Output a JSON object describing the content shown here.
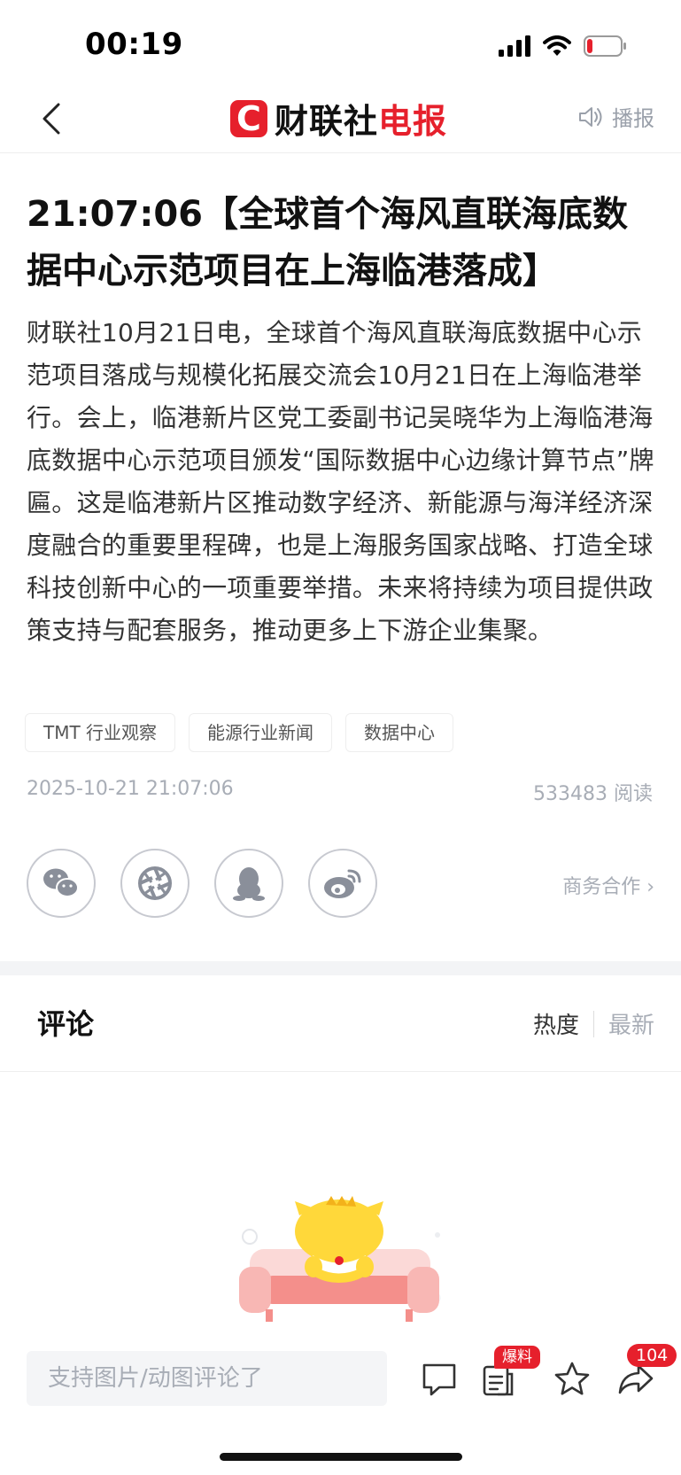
{
  "status": {
    "time": "00:19"
  },
  "nav": {
    "logo_letter": "C",
    "logo_black": "财联社",
    "logo_red": "电报",
    "broadcast_label": "播报"
  },
  "article": {
    "title": "21:07:06【全球首个海风直联海底数据中心示范项目在上海临港落成】",
    "body": "财联社10月21日电，全球首个海风直联海底数据中心示范项目落成与规模化拓展交流会10月21日在上海临港举行。会上，临港新片区党工委副书记吴晓华为上海临港海底数据中心示范项目颁发“国际数据中心边缘计算节点”牌匾。这是临港新片区推动数字经济、新能源与海洋经济深度融合的重要里程碑，也是上海服务国家战略、打造全球科技创新中心的一项重要举措。未来将持续为项目提供政策支持与配套服务，推动更多上下游企业集聚。",
    "tags": [
      "TMT 行业观察",
      "能源行业新闻",
      "数据中心"
    ],
    "date": "2025-10-21 21:07:06",
    "reads": "533483 阅读"
  },
  "share": {
    "icons": [
      "wechat-icon",
      "moments-icon",
      "qq-icon",
      "weibo-icon"
    ],
    "business_label": "商务合作 ›"
  },
  "comments": {
    "title": "评论",
    "sort_hot": "热度",
    "sort_new": "最新"
  },
  "bottom": {
    "input_placeholder": "支持图片/动图评论了",
    "baoliao_badge": "爆料",
    "share_count": "104"
  },
  "colors": {
    "brand_red": "#e6202c",
    "muted": "#a8adb6"
  }
}
